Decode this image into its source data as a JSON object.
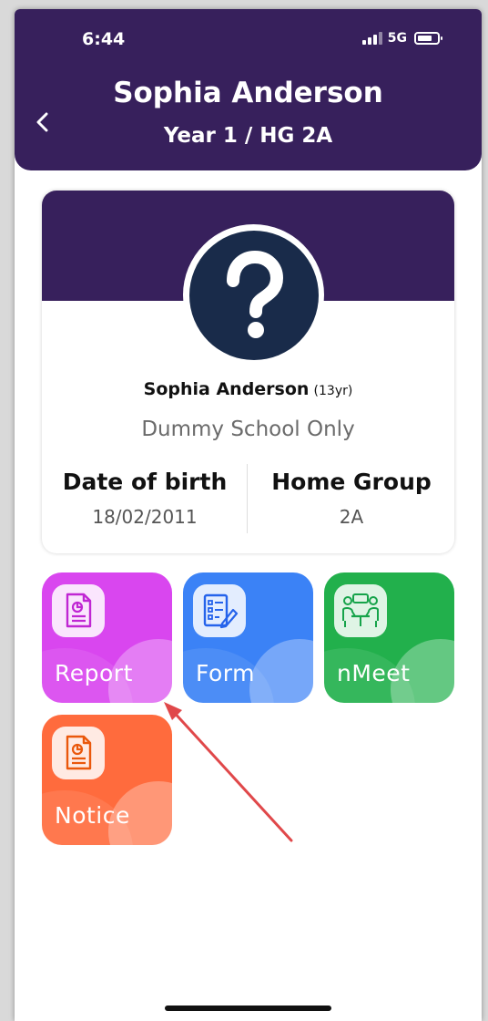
{
  "status_bar": {
    "time": "6:44",
    "network": "5G"
  },
  "header": {
    "title": "Sophia Anderson",
    "subtitle": "Year 1 / HG 2A"
  },
  "profile": {
    "name": "Sophia Anderson",
    "age": "(13yr)",
    "school": "Dummy School Only",
    "avatar_icon": "question-mark-icon",
    "dob_label": "Date of birth",
    "dob_value": "18/02/2011",
    "group_label": "Home Group",
    "group_value": "2A"
  },
  "tiles": [
    {
      "label": "Report",
      "icon": "report-icon",
      "color": "#d946ef"
    },
    {
      "label": "Form",
      "icon": "form-icon",
      "color": "#3b82f6"
    },
    {
      "label": "nMeet",
      "icon": "meeting-icon",
      "color": "#22b04c"
    },
    {
      "label": "Notice",
      "icon": "notice-icon",
      "color": "#ff6b3d"
    }
  ],
  "colors": {
    "header": "#37205c",
    "avatar": "#192b4a",
    "annotation_arrow": "#e0484a"
  }
}
